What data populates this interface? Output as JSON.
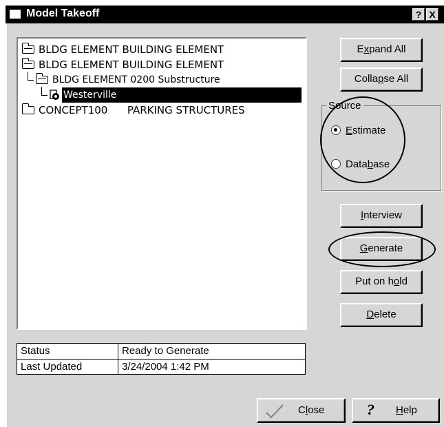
{
  "window": {
    "title": "Model Takeoff",
    "help_btn": "?",
    "close_btn": "X"
  },
  "tree": {
    "items": [
      {
        "icon": "folder-open-icon",
        "text": "BLDG ELEMENT  BUILDING ELEMENT",
        "level": 0,
        "selected": false
      },
      {
        "icon": "folder-open-icon",
        "text": "BLDG ELEMENT  BUILDING ELEMENT",
        "level": 0,
        "selected": false
      },
      {
        "icon": "folder-open-icon",
        "text": "BLDG ELEMENT 0200  Substructure",
        "level": 1,
        "selected": false
      },
      {
        "icon": "model-icon",
        "text": "Westerville",
        "level": 2,
        "selected": true
      },
      {
        "icon": "folder-closed-icon",
        "text": "CONCEPT100      PARKING STRUCTURES",
        "level": 0,
        "selected": false
      }
    ]
  },
  "buttons": {
    "expand_all": {
      "pre": "E",
      "ul": "x",
      "post": "pand All"
    },
    "collapse_all": {
      "pre": "Colla",
      "ul": "p",
      "post": "se All"
    },
    "interview": {
      "pre": "",
      "ul": "I",
      "post": "nterview"
    },
    "generate": {
      "pre": "",
      "ul": "G",
      "post": "enerate"
    },
    "put_on_hold": {
      "pre": "Put on h",
      "ul": "o",
      "post": "ld"
    },
    "delete": {
      "pre": "",
      "ul": "D",
      "post": "elete"
    },
    "close": {
      "pre": "C",
      "ul": "l",
      "post": "ose"
    },
    "help": {
      "pre": "",
      "ul": "H",
      "post": "elp"
    }
  },
  "source": {
    "label": "Source",
    "options": [
      {
        "pre": "",
        "ul": "E",
        "post": "stimate",
        "checked": true
      },
      {
        "pre": "Data",
        "ul": "b",
        "post": "ase",
        "checked": false
      }
    ]
  },
  "status": {
    "rows": [
      {
        "key": "Status",
        "value": "Ready to Generate"
      },
      {
        "key": "Last Updated",
        "value": "3/24/2004  1:42 PM"
      }
    ]
  }
}
